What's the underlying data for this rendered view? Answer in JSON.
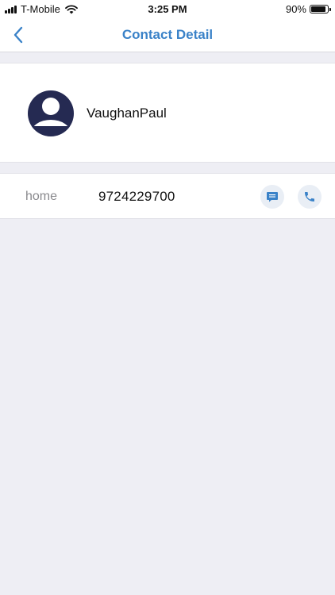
{
  "status_bar": {
    "carrier": "T-Mobile",
    "time": "3:25 PM",
    "battery_percent": "90%",
    "battery_level": 0.9,
    "signal_icon": "signal-bars-icon",
    "wifi_icon": "wifi-icon"
  },
  "nav": {
    "title": "Contact Detail",
    "back_icon": "chevron-left-icon"
  },
  "contact": {
    "name": "VaughanPaul",
    "avatar_icon": "person-avatar-icon",
    "phones": [
      {
        "label": "home",
        "number": "9724229700"
      }
    ]
  },
  "actions": {
    "message_icon": "message-icon",
    "call_icon": "phone-icon"
  },
  "colors": {
    "accent": "#3a82c8",
    "avatar": "#252a52",
    "background": "#eeeef4",
    "action_bg": "#e9eef5"
  }
}
